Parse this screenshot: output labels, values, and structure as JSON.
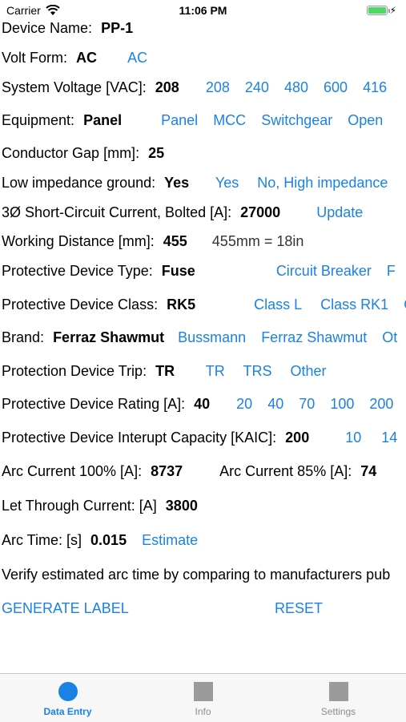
{
  "status_bar": {
    "carrier": "Carrier",
    "time": "11:06 PM"
  },
  "form": {
    "device_name": {
      "label": "Device Name:",
      "value": "PP-1"
    },
    "volt_form": {
      "label": "Volt Form:",
      "value": "AC",
      "options": [
        "AC"
      ]
    },
    "system_voltage": {
      "label": "System Voltage [VAC]:",
      "value": "208",
      "options": [
        "208",
        "240",
        "480",
        "600",
        "416"
      ]
    },
    "equipment": {
      "label": "Equipment:",
      "value": "Panel",
      "options": [
        "Panel",
        "MCC",
        "Switchgear",
        "Open"
      ]
    },
    "conductor_gap": {
      "label": "Conductor Gap [mm]:",
      "value": "25"
    },
    "low_impedance_ground": {
      "label": "Low impedance ground:",
      "value": "Yes",
      "options": [
        "Yes",
        "No, High impedance"
      ]
    },
    "short_circuit": {
      "label": "3Ø Short-Circuit Current, Bolted [A]:",
      "value": "27000",
      "button": "Update"
    },
    "working_distance": {
      "label": "Working Distance [mm]:",
      "value": "455",
      "note": "455mm = 18in"
    },
    "protective_device_type": {
      "label": "Protective Device Type:",
      "value": "Fuse",
      "options": [
        "Circuit Breaker",
        "F"
      ]
    },
    "protective_device_class": {
      "label": "Protective Device Class:",
      "value": "RK5",
      "options": [
        "Class L",
        "Class RK1",
        "C"
      ]
    },
    "brand": {
      "label": "Brand:",
      "value": "Ferraz Shawmut",
      "options": [
        "Bussmann",
        "Ferraz Shawmut",
        "Ot"
      ]
    },
    "protection_device_trip": {
      "label": "Protection Device Trip:",
      "value": "TR",
      "options": [
        "TR",
        "TRS",
        "Other"
      ]
    },
    "protective_device_rating": {
      "label": "Protective Device Rating [A]:",
      "value": "40",
      "options": [
        "20",
        "40",
        "70",
        "100",
        "200"
      ]
    },
    "interupt_capacity": {
      "label": "Protective Device Interupt Capacity [KAIC]:",
      "value": "200",
      "options": [
        "10",
        "14"
      ]
    },
    "arc_current": {
      "label_100": "Arc Current 100% [A]:",
      "value_100": "8737",
      "label_85": "Arc Current 85% [A]:",
      "value_85": "74"
    },
    "let_through": {
      "label": "Let Through Current: [A]",
      "value": "3800"
    },
    "arc_time": {
      "label": "Arc Time: [s]",
      "value": "0.015",
      "button": "Estimate"
    },
    "verify_text": "Verify estimated arc time by comparing to manufacturers pub"
  },
  "actions": {
    "generate": "GENERATE LABEL",
    "reset": "RESET"
  },
  "tabs": [
    {
      "label": "Data Entry",
      "icon": "circle-icon",
      "active": true
    },
    {
      "label": "Info",
      "icon": "square-icon",
      "active": false
    },
    {
      "label": "Settings",
      "icon": "square-icon",
      "active": false
    }
  ],
  "colors": {
    "accent": "#1a82e3",
    "battery": "#4cd964"
  }
}
